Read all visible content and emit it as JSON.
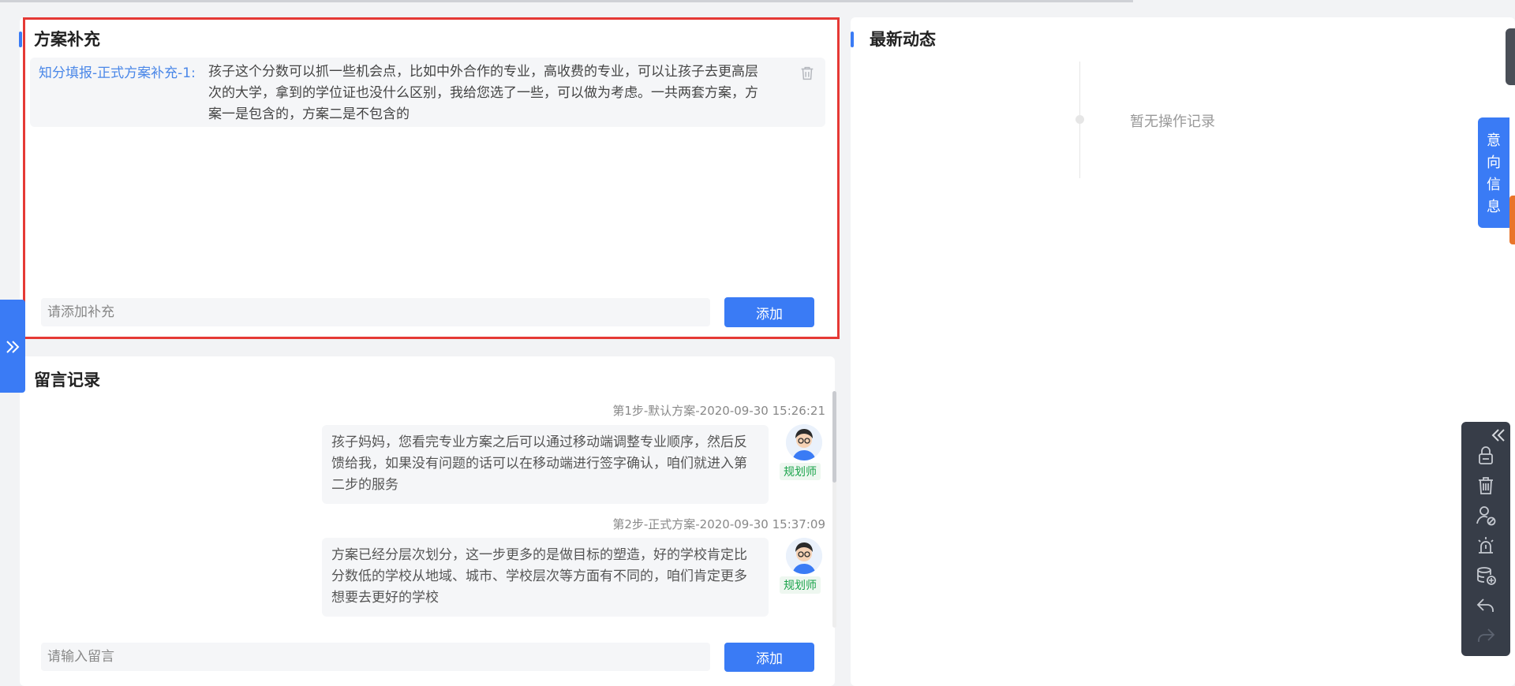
{
  "plan_supplement": {
    "title": "方案补充",
    "item": {
      "label": "知分填报-正式方案补充-1:",
      "text": "孩子这个分数可以抓一些机会点，比如中外合作的专业，高收费的专业，可以让孩子去更高层次的大学，拿到的学位证也没什么区别，我给您选了一些，可以做为考虑。一共两套方案，方案一是包含的，方案二是不包含的"
    },
    "input_placeholder": "请添加补充",
    "add_label": "添加"
  },
  "messages": {
    "title": "留言记录",
    "items": [
      {
        "time": "第1步-默认方案-2020-09-30 15:26:21",
        "text": "孩子妈妈，您看完专业方案之后可以通过移动端调整专业顺序，然后反馈给我，如果没有问题的话可以在移动端进行签字确认，咱们就进入第二步的服务",
        "role": "规划师"
      },
      {
        "time": "第2步-正式方案-2020-09-30 15:37:09",
        "text": "方案已经分层次划分，这一步更多的是做目标的塑造，好的学校肯定比分数低的学校从地域、城市、学校层次等方面有不同的，咱们肯定更多想要去更好的学校",
        "role": "规划师"
      }
    ],
    "input_placeholder": "请输入留言",
    "add_label": "添加"
  },
  "latest_activity": {
    "title": "最新动态",
    "empty_text": "暂无操作记录"
  },
  "side_tab": {
    "label": "意向信息"
  },
  "icons": {
    "left_tab": "double-chevron-right-icon",
    "toolbar_collapse": "double-chevron-left-icon",
    "toolbar": [
      "lock-icon",
      "trash-icon",
      "user-block-icon",
      "alarm-icon",
      "database-add-icon",
      "undo-icon",
      "redo-icon"
    ]
  },
  "colors": {
    "primary": "#3a7bf5",
    "highlight_border": "#e53935",
    "role_tag": "#1aa34a",
    "toolbar_bg": "#373d48"
  }
}
